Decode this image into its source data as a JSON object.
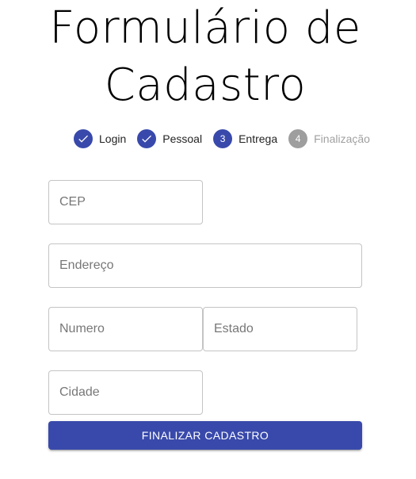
{
  "page": {
    "title_line1": "Formulário de",
    "title_line2": "Cadastro"
  },
  "stepper": {
    "steps": [
      {
        "label": "Login",
        "state": "completed",
        "icon": "check-icon"
      },
      {
        "label": "Pessoal",
        "state": "completed",
        "icon": "check-icon"
      },
      {
        "label": "Entrega",
        "state": "active",
        "number": "3"
      },
      {
        "label": "Finalização",
        "state": "inactive",
        "number": "4"
      }
    ]
  },
  "form": {
    "cep": {
      "placeholder": "CEP",
      "value": ""
    },
    "endereco": {
      "placeholder": "Endereço",
      "value": ""
    },
    "numero": {
      "placeholder": "Numero",
      "value": ""
    },
    "estado": {
      "placeholder": "Estado",
      "value": ""
    },
    "cidade": {
      "placeholder": "Cidade",
      "value": ""
    },
    "submit_label": "FINALIZAR CADASTRO"
  },
  "colors": {
    "primary": "#3949ab",
    "inactive": "#9e9e9e"
  }
}
